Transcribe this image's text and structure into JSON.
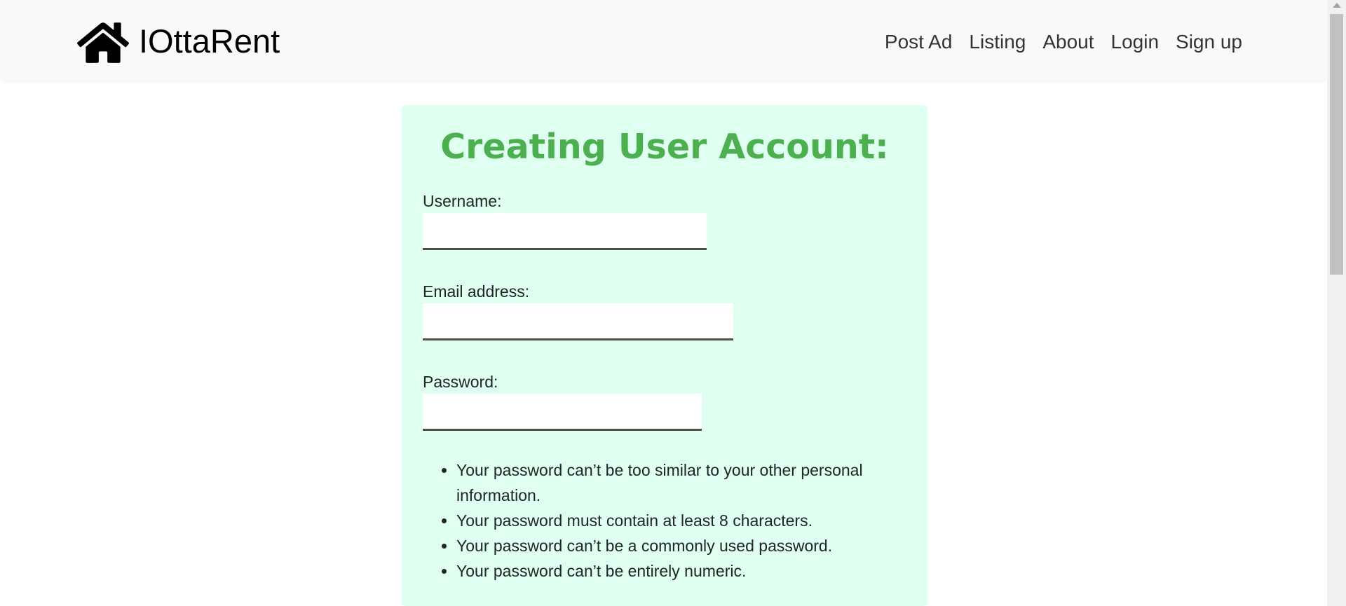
{
  "navbar": {
    "brand_name": "IOttaRent",
    "brand_icon": "home-icon",
    "links": [
      {
        "label": "Post Ad"
      },
      {
        "label": "Listing"
      },
      {
        "label": "About"
      },
      {
        "label": "Login"
      },
      {
        "label": "Sign up"
      }
    ]
  },
  "form": {
    "title": "Creating User Account:",
    "username": {
      "label": "Username:",
      "value": "",
      "placeholder": ""
    },
    "email": {
      "label": "Email address:",
      "value": "",
      "placeholder": ""
    },
    "password": {
      "label": "Password:",
      "value": "",
      "placeholder": ""
    },
    "password_help": [
      "Your password can’t be too similar to your other personal information.",
      "Your password must contain at least 8 characters.",
      "Your password can’t be a commonly used password.",
      "Your password can’t be entirely numeric."
    ]
  },
  "colors": {
    "title": "#4caf50",
    "card_background": "#dffff0",
    "navbar_background": "#f8f9fa"
  }
}
